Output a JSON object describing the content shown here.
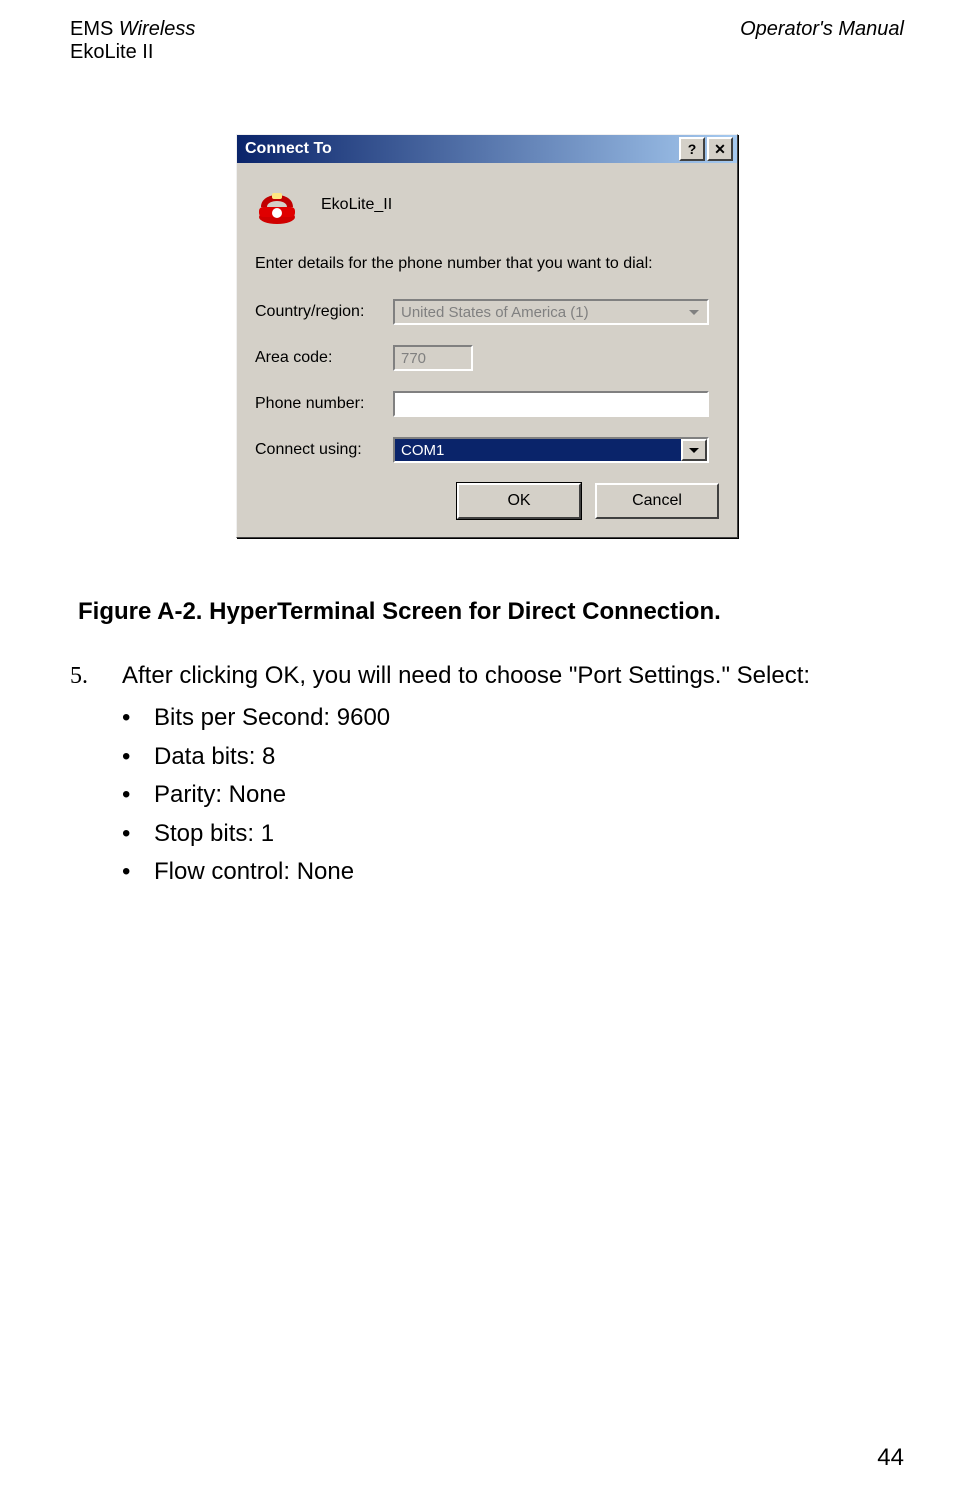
{
  "header": {
    "left_line1_a": "EMS ",
    "left_line1_b": "Wireless",
    "left_line2": "EkoLite II",
    "right": "Operator's Manual"
  },
  "dialog": {
    "title": "Connect To",
    "help_glyph": "?",
    "close_glyph": "✕",
    "connection_name": "EkoLite_II",
    "instruction": "Enter details for the phone number that you want to dial:",
    "labels": {
      "country": "Country/region:",
      "area": "Area code:",
      "phone": "Phone number:",
      "connect": "Connect using:"
    },
    "values": {
      "country": "United States of America (1)",
      "area": "770",
      "phone": "",
      "connect": "COM1"
    },
    "buttons": {
      "ok": "OK",
      "cancel": "Cancel"
    }
  },
  "figure_caption": "Figure A-2.  HyperTerminal Screen for Direct Connection.",
  "step": {
    "number": "5.",
    "text": "After clicking OK, you will need to choose \"Port Settings.\" Select:"
  },
  "bullets": [
    "Bits per Second: 9600",
    "Data bits: 8",
    "Parity: None",
    "Stop bits: 1",
    "Flow control: None"
  ],
  "page_number": "44"
}
